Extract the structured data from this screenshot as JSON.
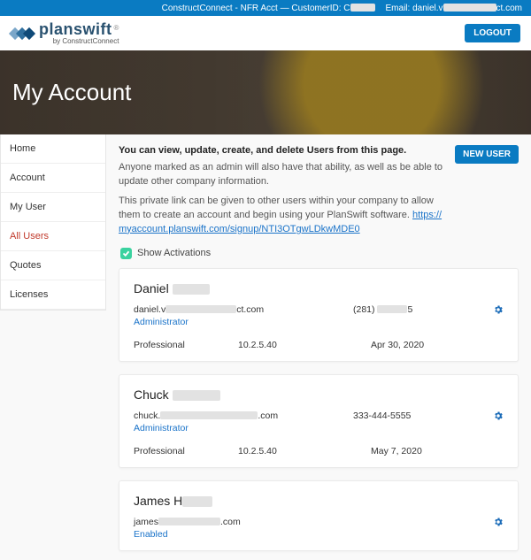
{
  "topbar": {
    "account_prefix": "ConstructConnect - NFR Acct —  CustomerID: C",
    "email_prefix": "Email: daniel.v",
    "email_suffix": "ct.com"
  },
  "logo": {
    "brand": "planswift",
    "byline": "by ConstructConnect"
  },
  "header": {
    "logout": "LOGOUT"
  },
  "hero": {
    "title": "My Account"
  },
  "sidebar": {
    "items": [
      {
        "label": "Home",
        "key": "home"
      },
      {
        "label": "Account",
        "key": "account"
      },
      {
        "label": "My User",
        "key": "myuser"
      },
      {
        "label": "All Users",
        "key": "allusers"
      },
      {
        "label": "Quotes",
        "key": "quotes"
      },
      {
        "label": "Licenses",
        "key": "licenses"
      }
    ],
    "active": "allusers"
  },
  "main": {
    "lead": "You can view, update, create, and delete Users from this page.",
    "p1": "Anyone marked as an admin will also have that ability, as well as be able to update other company information.",
    "p2a": "This private link can be given to other users within your company to allow them to create an account and begin using your PlanSwift software. ",
    "link": "https://myaccount.planswift.com/signup/NTI3OTgwLDkwMDE0",
    "new_user": "NEW USER",
    "show_activations": "Show Activations"
  },
  "users": [
    {
      "name_first": "Daniel",
      "email_prefix": "daniel.v",
      "email_suffix": "ct.com",
      "role": "Administrator",
      "phone_prefix": "(281)",
      "phone_suffix": "5",
      "plan": "Professional",
      "version": "10.2.5.40",
      "date": "Apr 30, 2020"
    },
    {
      "name_first": "Chuck",
      "email_prefix": "chuck.",
      "email_suffix": ".com",
      "role": "Administrator",
      "phone_full": "333-444-5555",
      "plan": "Professional",
      "version": "10.2.5.40",
      "date": "May 7, 2020"
    },
    {
      "name_first": "James H",
      "email_prefix": "james",
      "email_suffix": ".com",
      "role": "Enabled",
      "phone_full": "",
      "plan": "",
      "version": "",
      "date": ""
    }
  ]
}
